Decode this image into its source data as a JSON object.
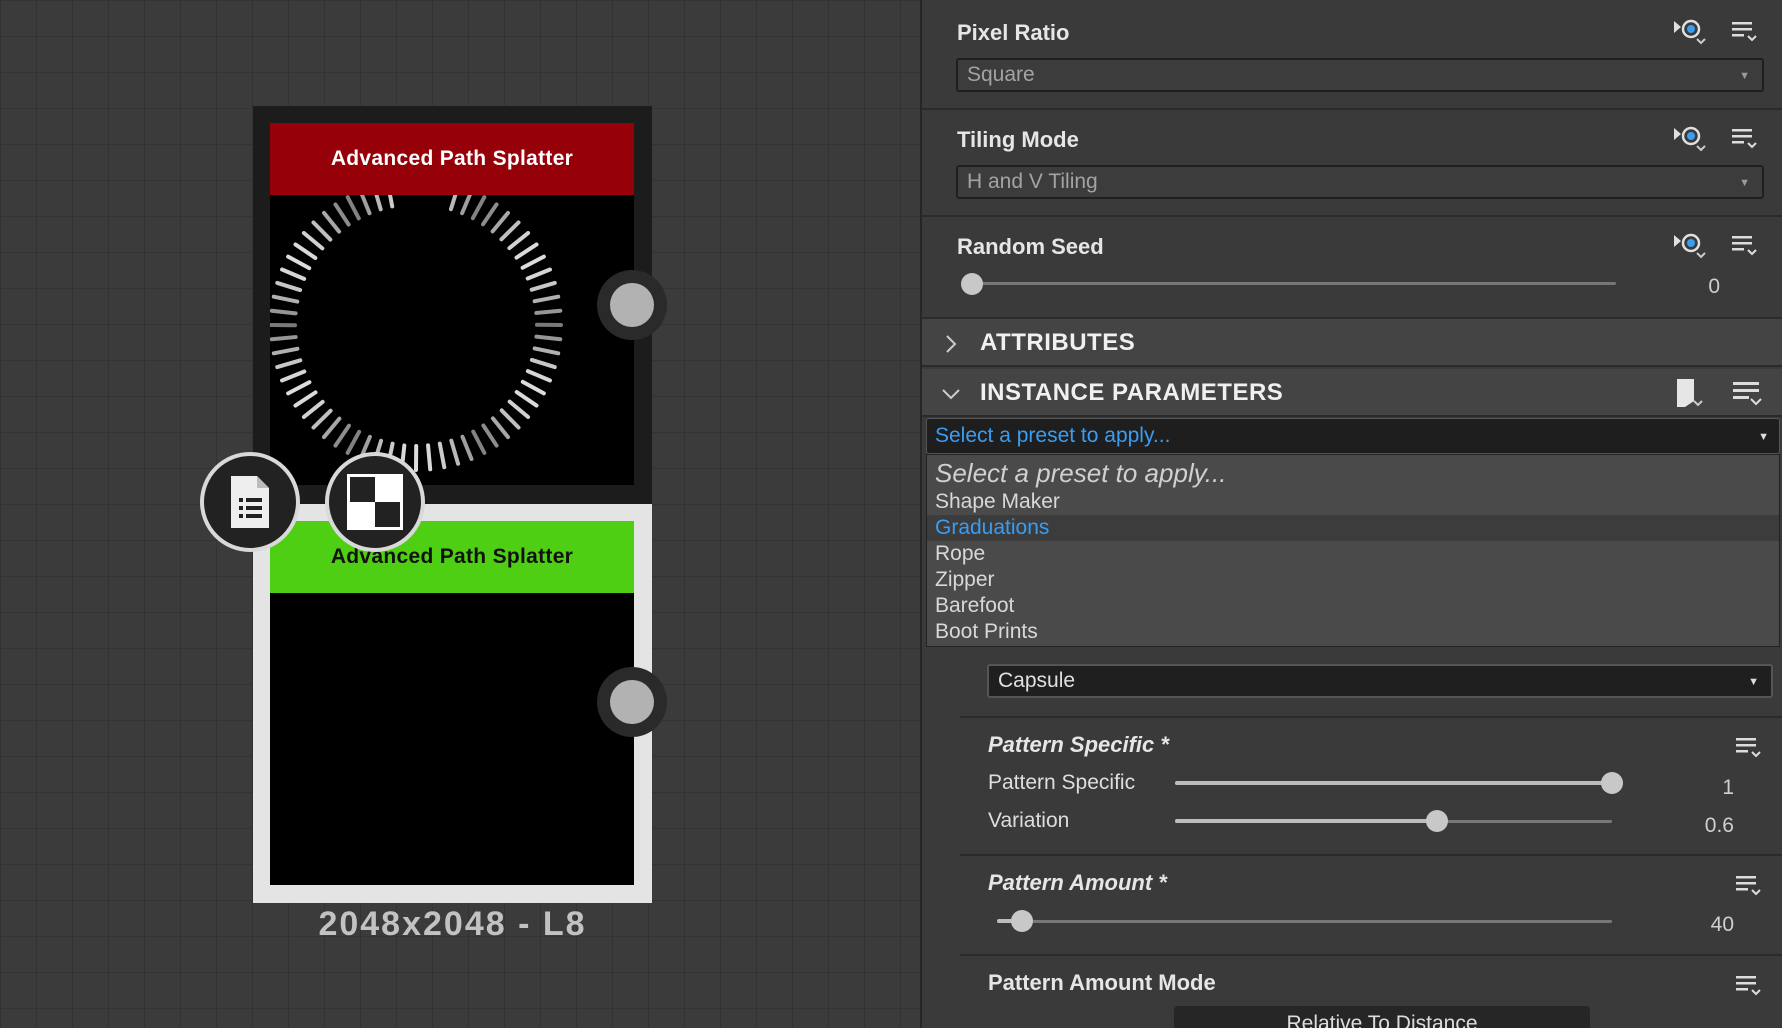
{
  "graph": {
    "node_top": {
      "title": "Advanced Path Splatter",
      "header_color": "#960008"
    },
    "node_bottom": {
      "title": "Advanced Path Splatter",
      "header_color": "#4fcf14"
    },
    "resolution_label": "2048x2048 - L8"
  },
  "panel": {
    "pixel_ratio": {
      "label": "Pixel Ratio",
      "value": "Square"
    },
    "tiling_mode": {
      "label": "Tiling Mode",
      "value": "H and V Tiling"
    },
    "random_seed": {
      "label": "Random Seed",
      "value": "0"
    },
    "attributes_label": "ATTRIBUTES",
    "instance_parameters_label": "INSTANCE PARAMETERS",
    "preset_combo": {
      "value": "Select a preset to apply..."
    },
    "preset_options": [
      {
        "label": "Select a preset to apply..."
      },
      {
        "label": "Shape Maker"
      },
      {
        "label": "Graduations"
      },
      {
        "label": "Rope"
      },
      {
        "label": "Zipper"
      },
      {
        "label": "Barefoot"
      },
      {
        "label": "Boot Prints"
      }
    ],
    "selected_preset": "Graduations",
    "shape_combo": {
      "value": "Capsule"
    },
    "pattern_specific": {
      "group_label": "Pattern Specific *",
      "row1_label": "Pattern Specific",
      "row1_value": "1",
      "row1_fraction": 1.0,
      "row2_label": "Variation",
      "row2_value": "0.6",
      "row2_fraction": 0.6
    },
    "pattern_amount": {
      "label": "Pattern Amount *",
      "value": "40",
      "fraction": 0.04
    },
    "pattern_amount_mode": {
      "label": "Pattern Amount Mode",
      "button": "Relative To Distance"
    }
  },
  "colors": {
    "accent_blue": "#3a9df2",
    "slider_knob": "#c8c8c8"
  },
  "icons": [
    "document-icon",
    "checker-icon",
    "pin-visibility-icon",
    "menu-list-icon",
    "chevron-right-icon",
    "chevron-down-icon",
    "preset-icon"
  ]
}
